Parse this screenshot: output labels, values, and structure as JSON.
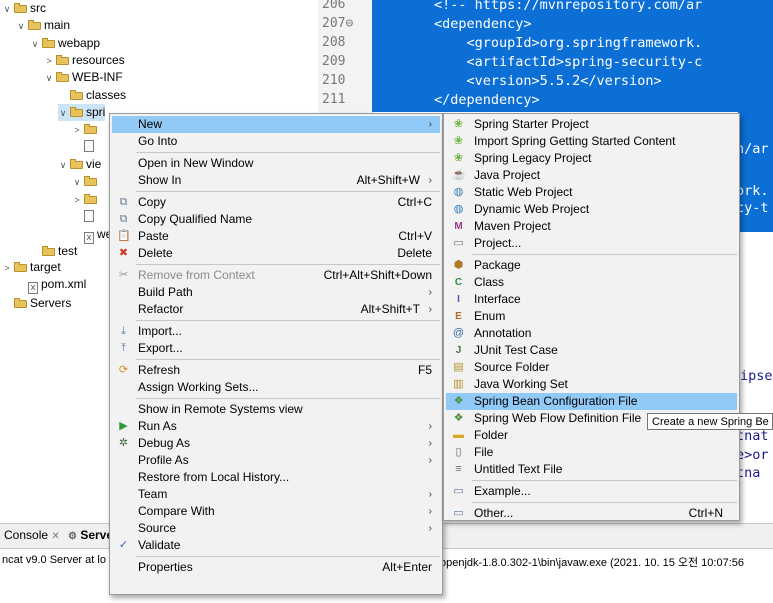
{
  "tree": {
    "items": [
      {
        "label": "src",
        "twisty": "∨",
        "icon": "folder"
      },
      {
        "label": "main",
        "twisty": "∨",
        "icon": "folder"
      },
      {
        "label": "webapp",
        "twisty": "∨",
        "icon": "folder"
      },
      {
        "label": "resources",
        "twisty": ">",
        "icon": "folder"
      },
      {
        "label": "WEB-INF",
        "twisty": "∨",
        "icon": "folder"
      },
      {
        "label": "classes",
        "twisty": "",
        "icon": "folder"
      },
      {
        "label": "spri",
        "twisty": "∨",
        "icon": "folder"
      },
      {
        "label": "",
        "twisty": ">",
        "icon": "folder"
      },
      {
        "label": "",
        "twisty": "",
        "icon": "file"
      },
      {
        "label": "vie",
        "twisty": "∨",
        "icon": "folder"
      },
      {
        "label": "",
        "twisty": "∨",
        "icon": "folder"
      },
      {
        "label": "",
        "twisty": ">",
        "icon": "folder"
      },
      {
        "label": "",
        "twisty": "",
        "icon": "file"
      },
      {
        "label": "we",
        "twisty": "",
        "icon": "xml"
      },
      {
        "label": "test",
        "twisty": "",
        "icon": "folder"
      },
      {
        "label": "target",
        "twisty": ">",
        "icon": "folder"
      },
      {
        "label": "pom.xml",
        "twisty": "",
        "icon": "xml"
      },
      {
        "label": "Servers",
        "twisty": "",
        "icon": "folder"
      }
    ]
  },
  "editor": {
    "line_numbers": [
      "206",
      "207⊖",
      "208",
      "209",
      "210",
      "211"
    ],
    "code_lines": [
      "<!-- https://mvnrepository.com/ar",
      "<dependency>",
      "    <groupId>org.springframework.",
      "    <artifactId>spring-security-c",
      "    <version>5.5.2</version>",
      "</dependency>"
    ],
    "fragments": [
      "n/ar",
      "ork.",
      "cy-t",
      "ipse",
      "tnat",
      "e>or",
      "tna"
    ]
  },
  "bottom": {
    "console_tab": "Console",
    "servers_tab": "Serve",
    "server_line_left": "ncat v9.0 Server at lo",
    "server_line_right": "openjdk-1.8.0.302-1\\bin\\javaw.exe  (2021. 10. 15 오전 10:07:56"
  },
  "context_menu": {
    "items": [
      {
        "label": "New",
        "shortcut": "",
        "submenu": true,
        "highlighted": true,
        "icon": ""
      },
      {
        "label": "Go Into",
        "shortcut": "",
        "submenu": false,
        "icon": ""
      },
      {
        "sep": true
      },
      {
        "label": "Open in New Window",
        "shortcut": "",
        "submenu": false,
        "icon": ""
      },
      {
        "label": "Show In",
        "shortcut": "Alt+Shift+W",
        "submenu": true,
        "icon": ""
      },
      {
        "sep": true
      },
      {
        "label": "Copy",
        "shortcut": "Ctrl+C",
        "submenu": false,
        "icon": "copy"
      },
      {
        "label": "Copy Qualified Name",
        "shortcut": "",
        "submenu": false,
        "icon": "copy"
      },
      {
        "label": "Paste",
        "shortcut": "Ctrl+V",
        "submenu": false,
        "icon": "paste"
      },
      {
        "label": "Delete",
        "shortcut": "Delete",
        "submenu": false,
        "icon": "delete"
      },
      {
        "sep": true
      },
      {
        "label": "Remove from Context",
        "shortcut": "Ctrl+Alt+Shift+Down",
        "submenu": false,
        "disabled": true,
        "icon": "remove"
      },
      {
        "label": "Build Path",
        "shortcut": "",
        "submenu": true,
        "icon": ""
      },
      {
        "label": "Refactor",
        "shortcut": "Alt+Shift+T",
        "submenu": true,
        "icon": ""
      },
      {
        "sep": true
      },
      {
        "label": "Import...",
        "shortcut": "",
        "submenu": false,
        "icon": "import"
      },
      {
        "label": "Export...",
        "shortcut": "",
        "submenu": false,
        "icon": "export"
      },
      {
        "sep": true
      },
      {
        "label": "Refresh",
        "shortcut": "F5",
        "submenu": false,
        "icon": "refresh"
      },
      {
        "label": "Assign Working Sets...",
        "shortcut": "",
        "submenu": false,
        "icon": ""
      },
      {
        "sep": true
      },
      {
        "label": "Show in Remote Systems view",
        "shortcut": "",
        "submenu": false,
        "icon": ""
      },
      {
        "label": "Run As",
        "shortcut": "",
        "submenu": true,
        "icon": "run"
      },
      {
        "label": "Debug As",
        "shortcut": "",
        "submenu": true,
        "icon": "debug"
      },
      {
        "label": "Profile As",
        "shortcut": "",
        "submenu": true,
        "icon": ""
      },
      {
        "label": "Restore from Local History...",
        "shortcut": "",
        "submenu": false,
        "icon": ""
      },
      {
        "label": "Team",
        "shortcut": "",
        "submenu": true,
        "icon": ""
      },
      {
        "label": "Compare With",
        "shortcut": "",
        "submenu": true,
        "icon": ""
      },
      {
        "label": "Source",
        "shortcut": "",
        "submenu": true,
        "icon": ""
      },
      {
        "label": "Validate",
        "shortcut": "",
        "submenu": false,
        "icon": "check"
      },
      {
        "sep": true
      },
      {
        "label": "Properties",
        "shortcut": "Alt+Enter",
        "submenu": false,
        "icon": ""
      }
    ]
  },
  "submenu": {
    "items": [
      {
        "label": "Spring Starter Project",
        "icon": "spring",
        "shortcut": ""
      },
      {
        "label": "Import Spring Getting Started Content",
        "icon": "spring",
        "shortcut": ""
      },
      {
        "label": "Spring Legacy Project",
        "icon": "spring",
        "shortcut": ""
      },
      {
        "label": "Java Project",
        "icon": "java-project",
        "shortcut": ""
      },
      {
        "label": "Static Web Project",
        "icon": "web",
        "shortcut": ""
      },
      {
        "label": "Dynamic Web Project",
        "icon": "web",
        "shortcut": ""
      },
      {
        "label": "Maven Project",
        "icon": "maven",
        "shortcut": ""
      },
      {
        "label": "Project...",
        "icon": "project",
        "shortcut": ""
      },
      {
        "sep": true
      },
      {
        "label": "Package",
        "icon": "package",
        "shortcut": ""
      },
      {
        "label": "Class",
        "icon": "class",
        "shortcut": ""
      },
      {
        "label": "Interface",
        "icon": "interface",
        "shortcut": ""
      },
      {
        "label": "Enum",
        "icon": "enum",
        "shortcut": ""
      },
      {
        "label": "Annotation",
        "icon": "annotation",
        "shortcut": ""
      },
      {
        "label": "JUnit Test Case",
        "icon": "junit",
        "shortcut": ""
      },
      {
        "label": "Source Folder",
        "icon": "source-folder",
        "shortcut": ""
      },
      {
        "label": "Java Working Set",
        "icon": "working-set",
        "shortcut": ""
      },
      {
        "label": "Spring Bean Configuration File",
        "icon": "spring-bean",
        "shortcut": "",
        "highlighted": true
      },
      {
        "label": "Spring Web Flow Definition File",
        "icon": "spring-bean",
        "shortcut": ""
      },
      {
        "label": "Folder",
        "icon": "folder",
        "shortcut": ""
      },
      {
        "label": "File",
        "icon": "file",
        "shortcut": ""
      },
      {
        "label": "Untitled Text File",
        "icon": "text-file",
        "shortcut": ""
      },
      {
        "sep": true
      },
      {
        "label": "Example...",
        "icon": "example",
        "shortcut": ""
      },
      {
        "sep": true
      },
      {
        "label": "Other...",
        "icon": "other",
        "shortcut": "Ctrl+N"
      }
    ]
  },
  "tooltip": {
    "text": "Create a new Spring Be"
  },
  "colors": {
    "selection": "#0b6fd6",
    "menu_highlight": "#91c9f7",
    "menu_bg": "#f2f2f2"
  }
}
